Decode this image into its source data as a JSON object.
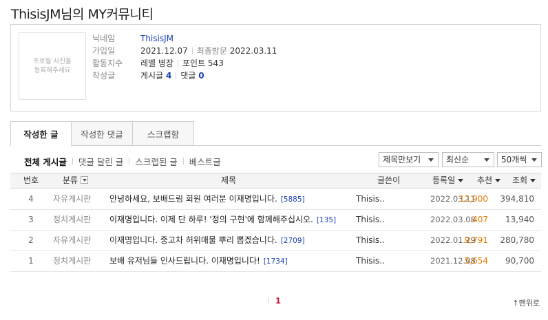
{
  "page": {
    "title": "ThisisJM님의 MY커뮤니티"
  },
  "profile": {
    "photo_placeholder": "프로필 사진을\n등록해주세요",
    "nickname_label": "닉네임",
    "nickname": "ThisisJM",
    "joined_label": "가입일",
    "joined": "2021.12.07",
    "last_visit_label": "최종방문",
    "last_visit": "2022.03.11",
    "activity_label": "활동지수",
    "level": "레벨 병장",
    "points": "포인트 543",
    "posts_label": "작성글",
    "posts_text": "게시글",
    "posts_count": "4",
    "comments_text": "댓글",
    "comments_count": "0"
  },
  "tabs": [
    "작성한 글",
    "작성한 댓글",
    "스크랩함"
  ],
  "filters": [
    "전체 게시글",
    "댓글 달린 글",
    "스크랩된 글",
    "베스트글"
  ],
  "selects": {
    "view": "제목만보기",
    "sort": "최신순",
    "per_page": "50개씩"
  },
  "table": {
    "headers": {
      "num": "번호",
      "category": "분류",
      "title": "제목",
      "author": "글쓴이",
      "date": "등록일",
      "likes": "추천",
      "views": "조회"
    },
    "rows": [
      {
        "num": "4",
        "category": "자유게시판",
        "title": "안녕하세요, 보배드림 회원 여러분 이재명입니다.",
        "replies": "[5885]",
        "author": "Thisis..",
        "date": "2022.03.11",
        "likes": "12,900",
        "views": "394,810"
      },
      {
        "num": "3",
        "category": "정치게시판",
        "title": "이재명입니다. 이제 단 하루! '정의 구현'에 함께해주십시오.",
        "replies": "[135]",
        "author": "Thisis..",
        "date": "2022.03.08",
        "likes": "407",
        "views": "13,940"
      },
      {
        "num": "2",
        "category": "자유게시판",
        "title": "이재명입니다. 중고차 허위매물 뿌리 뽑겠습니다.",
        "replies": "[2709]",
        "author": "Thisis..",
        "date": "2022.01.29",
        "likes": "9,791",
        "views": "280,780"
      },
      {
        "num": "1",
        "category": "정치게시판",
        "title": "보배 유저님들 인사드립니다. 이재명입니다!",
        "replies": "[1734]",
        "author": "Thisis..",
        "date": "2021.12.08",
        "likes": "5,654",
        "views": "90,700"
      }
    ]
  },
  "pagination": {
    "current": "1"
  },
  "footer": {
    "top_link": "↑맨위로"
  }
}
